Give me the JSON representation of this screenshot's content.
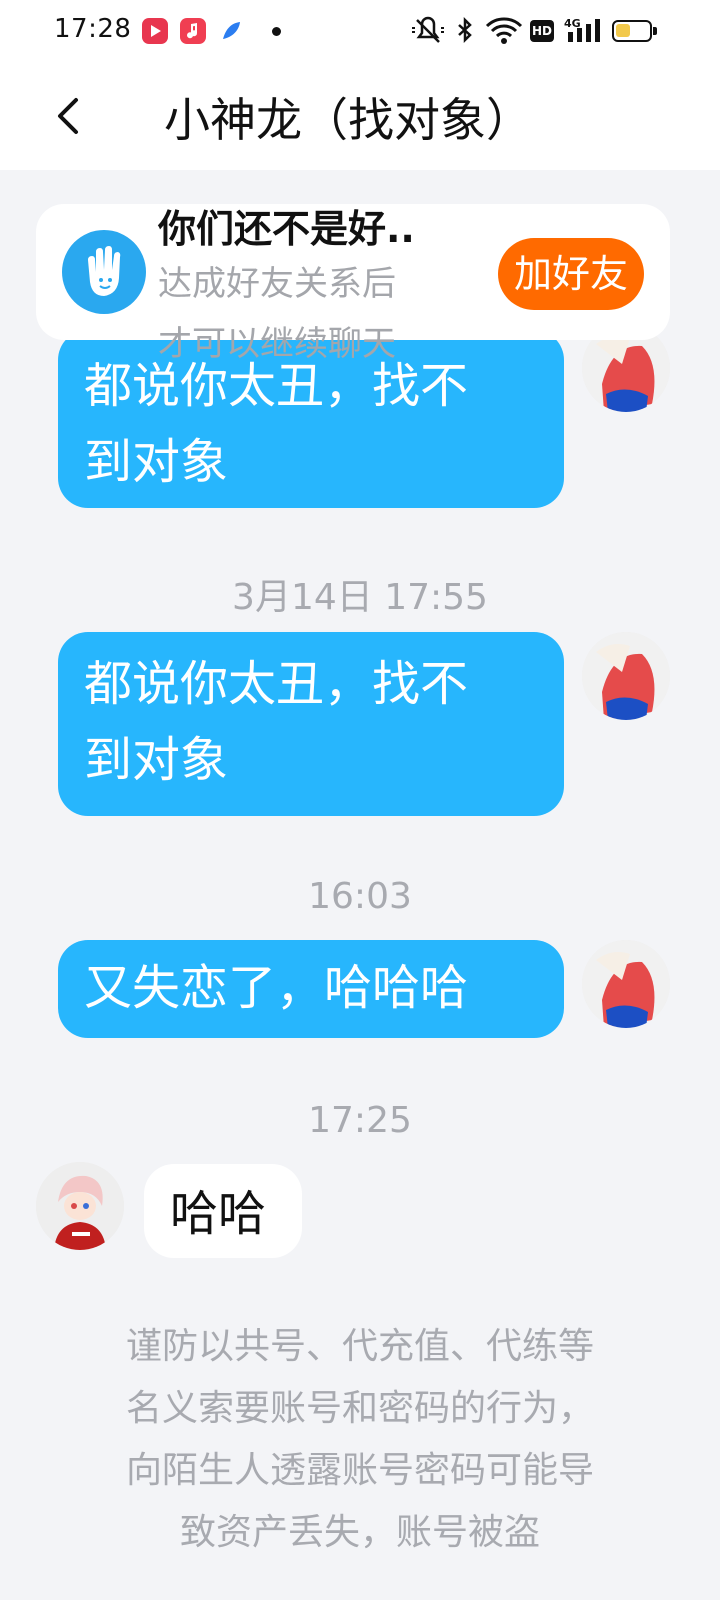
{
  "status_bar": {
    "time": "17:28",
    "hd_label": "HD",
    "network_label": "4G",
    "icons": [
      "video-app-icon",
      "music-app-icon",
      "feather-app-icon",
      "notification-dot",
      "mute-icon",
      "bluetooth-icon",
      "wifi-icon",
      "hd-icon",
      "signal-icon",
      "battery-icon"
    ]
  },
  "nav": {
    "back_icon": "chevron-left-icon",
    "title": "小神龙（找对象）"
  },
  "friend_card": {
    "icon": "hand-wave-icon",
    "title": "你们还不是好..",
    "description_line1": "达成好友关系后",
    "description_line2": "才可以继续聊天",
    "button_label": "加好友",
    "button_color": "#ff6a00"
  },
  "messages": [
    {
      "side": "right",
      "text_line1": "都说你太丑，找不",
      "text_line2": "到对象"
    },
    {
      "timestamp": "3月14日 17:55"
    },
    {
      "side": "right",
      "text_line1": "都说你太丑，找不",
      "text_line2": "到对象"
    },
    {
      "timestamp": "16:03"
    },
    {
      "side": "right",
      "text_line1": "又失恋了，哈哈哈"
    },
    {
      "timestamp": "17:25"
    },
    {
      "side": "left",
      "text_line1": "哈哈"
    }
  ],
  "notice": {
    "line1": "谨防以共号、代充值、代练等",
    "line2": "名义索要账号和密码的行为，",
    "line3": "向陌生人透露账号密码可能导",
    "line4": "致资产丢失，账号被盗"
  },
  "colors": {
    "bubble_self": "#27b6fd",
    "bubble_other": "#ffffff",
    "background": "#f3f4f7",
    "muted_text": "#a8aab0"
  }
}
